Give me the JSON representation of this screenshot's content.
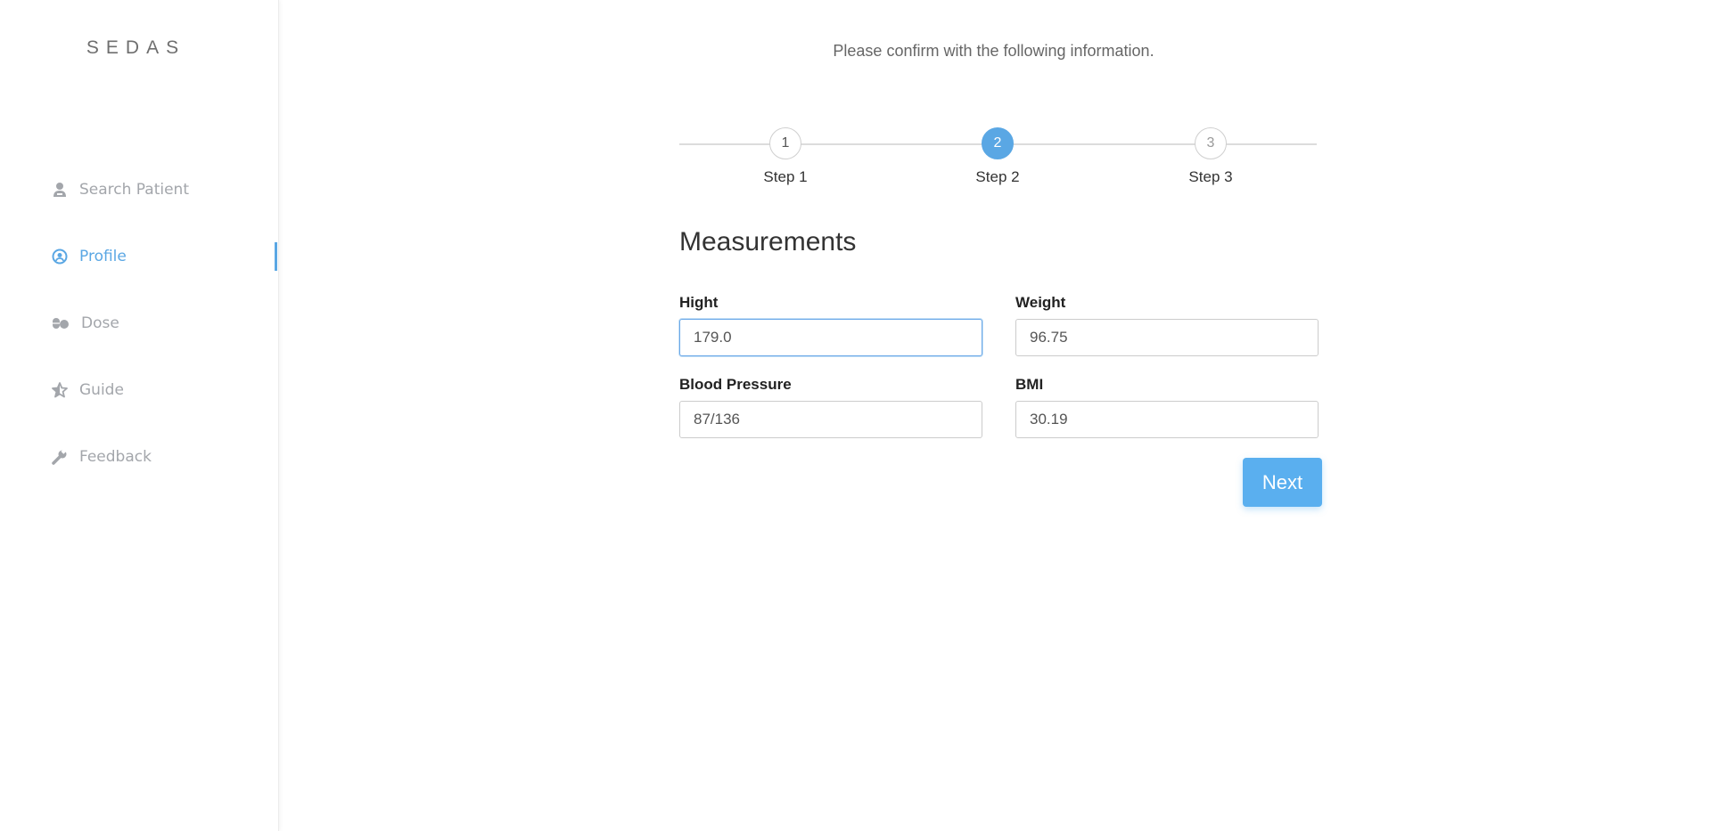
{
  "app": {
    "brand": "SEDAS"
  },
  "sidebar": {
    "items": [
      {
        "label": "Search Patient",
        "icon": "user-doctor-icon",
        "active": false
      },
      {
        "label": "Profile",
        "icon": "user-circle-icon",
        "active": true
      },
      {
        "label": "Dose",
        "icon": "pills-icon",
        "active": false
      },
      {
        "label": "Guide",
        "icon": "star-icon",
        "active": false
      },
      {
        "label": "Feedback",
        "icon": "wrench-icon",
        "active": false
      }
    ]
  },
  "main": {
    "intro": "Please confirm with the following information.",
    "steps": [
      {
        "number": "1",
        "label": "Step 1",
        "state": "done"
      },
      {
        "number": "2",
        "label": "Step 2",
        "state": "active"
      },
      {
        "number": "3",
        "label": "Step 3",
        "state": "future"
      }
    ],
    "section_title": "Measurements",
    "fields": {
      "height": {
        "label": "Hight",
        "value": "179.0"
      },
      "weight": {
        "label": "Weight",
        "value": "96.75"
      },
      "blood_pressure": {
        "label": "Blood Pressure",
        "value": "87/136"
      },
      "bmi": {
        "label": "BMI",
        "value": "30.19"
      }
    },
    "next_label": "Next"
  },
  "colors": {
    "accent": "#5aa7e4",
    "button": "#5aafef",
    "sidebar_text": "#a3a6ab"
  }
}
